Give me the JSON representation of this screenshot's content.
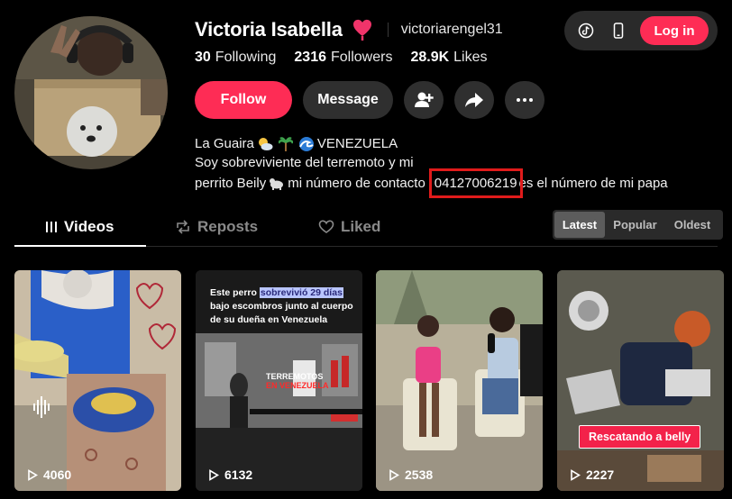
{
  "profile": {
    "display_name": "Victoria Isabella",
    "username": "victoriarengel31",
    "following_count": "30",
    "following_label": "Following",
    "followers_count": "2316",
    "followers_label": "Followers",
    "likes_count": "28.9K",
    "likes_label": "Likes"
  },
  "actions": {
    "follow_label": "Follow",
    "message_label": "Message"
  },
  "bio": {
    "line1": "La Guaira",
    "line1_country": "VENEZUELA",
    "line2": "Soy sobreviviente del terremoto y mi",
    "line3_pre": "perrito Beily",
    "line3_mid": "mi número de contacto",
    "contact": "04127006219",
    "line3_post": "es el número de mi papa"
  },
  "topbar": {
    "login_label": "Log in"
  },
  "tabs": [
    {
      "label": "Videos"
    },
    {
      "label": "Reposts"
    },
    {
      "label": "Liked"
    }
  ],
  "sort": [
    {
      "label": "Latest"
    },
    {
      "label": "Popular"
    },
    {
      "label": "Oldest"
    }
  ],
  "videos": [
    {
      "views": "4060"
    },
    {
      "views": "6132",
      "caption_pre": "Este perro",
      "caption_hl": "sobrevivió 29 días",
      "caption_post": "bajo escombros junto al cuerpo de su dueña en Venezuela",
      "news_line1": "TERREMOTOS",
      "news_line2": "EN VENEZUELA"
    },
    {
      "views": "2538"
    },
    {
      "views": "2227",
      "chip": "Rescatando a belly"
    }
  ],
  "colors": {
    "accent": "#fe2c55",
    "highlight_box": "#e01b1b"
  }
}
